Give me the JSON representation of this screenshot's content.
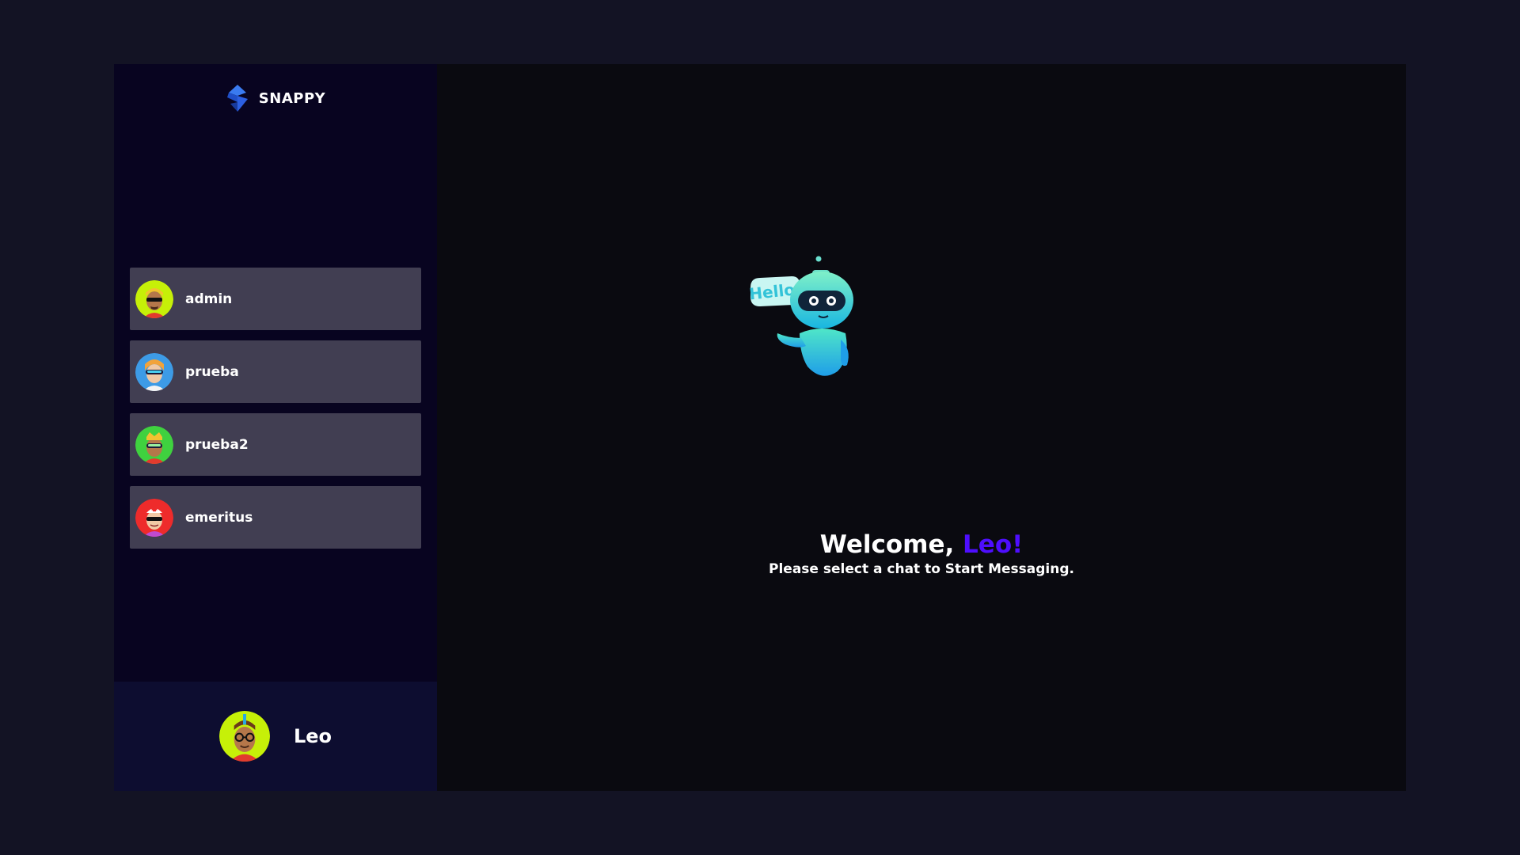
{
  "app": {
    "brand_name": "SNAPPY",
    "logo_icon": "snappy-logo-icon"
  },
  "contacts": [
    {
      "name": "admin",
      "avatar": "avatar-sunglasses-icon",
      "color": "#c6f008"
    },
    {
      "name": "prueba",
      "avatar": "avatar-visor-icon",
      "color": "#3d9be6"
    },
    {
      "name": "prueba2",
      "avatar": "avatar-crown-icon",
      "color": "#3fd13f"
    },
    {
      "name": "emeritus",
      "avatar": "avatar-nurse-icon",
      "color": "#ee2b2b"
    }
  ],
  "current_user": {
    "name": "Leo",
    "avatar": "avatar-glasses-icon",
    "color": "#c6f008"
  },
  "welcome": {
    "greeting": "Welcome, ",
    "username": "Leo!",
    "subtitle": "Please select a chat to Start Messaging.",
    "robot_bubble": "Hello!"
  },
  "colors": {
    "page_bg": "#131324",
    "sidebar_bg": "#080420",
    "contact_bg": "#413e52",
    "current_user_bg": "#0d0d30",
    "main_bg": "#0a0a10",
    "accent": "#4e0eff"
  }
}
